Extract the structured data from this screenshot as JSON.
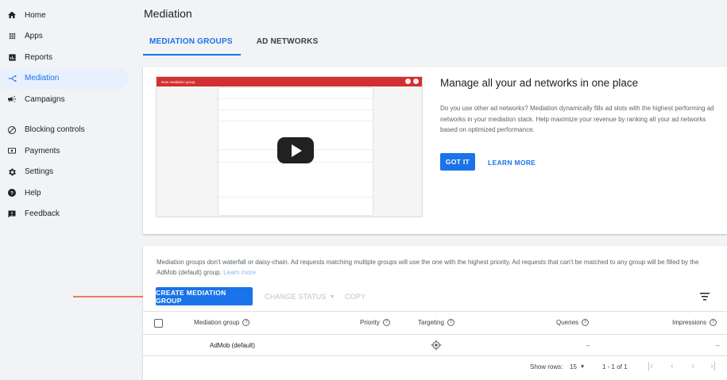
{
  "sidebar": {
    "items": [
      {
        "label": "Home",
        "icon": "home-icon"
      },
      {
        "label": "Apps",
        "icon": "apps-grid-icon"
      },
      {
        "label": "Reports",
        "icon": "bar-chart-icon"
      },
      {
        "label": "Mediation",
        "icon": "mediation-icon",
        "active": true
      },
      {
        "label": "Campaigns",
        "icon": "megaphone-icon"
      },
      {
        "label": "Blocking controls",
        "icon": "block-icon"
      },
      {
        "label": "Payments",
        "icon": "payments-icon"
      },
      {
        "label": "Settings",
        "icon": "gear-icon"
      },
      {
        "label": "Help",
        "icon": "help-icon"
      },
      {
        "label": "Feedback",
        "icon": "feedback-icon"
      }
    ]
  },
  "page": {
    "title": "Mediation",
    "tabs": [
      {
        "label": "MEDIATION GROUPS",
        "active": true
      },
      {
        "label": "AD NETWORKS",
        "active": false
      }
    ]
  },
  "promo": {
    "title": "Manage all your ad networks in one place",
    "text": "Do you use other ad networks? Mediation dynamically fills ad slots with the highest performing ad networks in your mediation stack. Help maximize your revenue by ranking all your ad networks based on optimized performance.",
    "got_it": "GOT IT",
    "learn_more": "LEARN MORE",
    "video_bar_title": "New mediation group"
  },
  "groups": {
    "info": "Mediation groups don't waterfall or daisy-chain. Ad requests matching multiple groups will use the one with the highest priority. Ad requests that can't be matched to any group will be filled by the AdMob (default) group.",
    "info_link": "Learn more",
    "create_button": "CREATE MEDIATION GROUP",
    "change_status": "CHANGE STATUS",
    "copy": "COPY",
    "columns": {
      "name": "Mediation group",
      "priority": "Priority",
      "targeting": "Targeting",
      "queries": "Queries",
      "impressions": "Impressions"
    },
    "rows": [
      {
        "name": "AdMob (default)",
        "queries": "–",
        "impressions": "–"
      }
    ],
    "pager": {
      "show_rows_label": "Show rows:",
      "rows_value": "15",
      "range": "1 - 1 of 1"
    }
  },
  "colors": {
    "accent": "#1a73e8",
    "arrow": "#e8572a",
    "video_bar": "#d32f2f"
  }
}
